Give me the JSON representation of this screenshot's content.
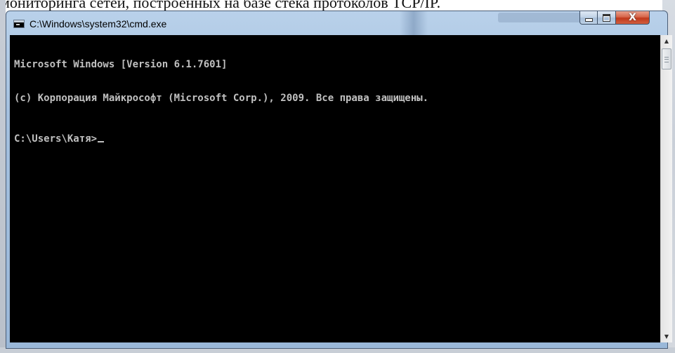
{
  "background_doc": {
    "text": "мониторинга сетей, построенных на базе стека протоколов TCP/IP."
  },
  "window": {
    "title": "C:\\Windows\\system32\\cmd.exe",
    "icon": "cmd-icon"
  },
  "caption_buttons": {
    "minimize_icon": "minimize-icon",
    "maximize_icon": "maximize-icon",
    "close_label": "X"
  },
  "console": {
    "line1": "Microsoft Windows [Version 6.1.7601]",
    "line2": "(c) Корпорация Майкрософт (Microsoft Corp.), 2009. Все права защищены.",
    "prompt": "C:\\Users\\Катя>",
    "text_color": "#c0c0c0",
    "background_color": "#000000"
  },
  "scrollbar": {
    "up_arrow": "▲",
    "down_arrow": "▼"
  }
}
